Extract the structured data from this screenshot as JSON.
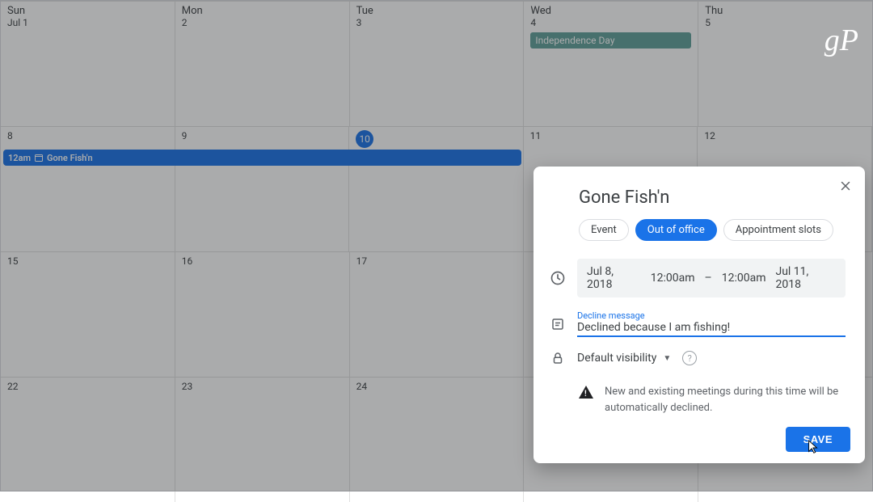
{
  "watermark": "gP",
  "calendar": {
    "weekdays": [
      "Sun",
      "Mon",
      "Tue",
      "Wed",
      "Thu"
    ],
    "today_weekday_index": 2,
    "weeks": [
      {
        "days": [
          {
            "label": "Jul 1"
          },
          {
            "label": "2"
          },
          {
            "label": "3"
          },
          {
            "label": "4",
            "holiday": "Independence Day"
          },
          {
            "label": "5"
          }
        ]
      },
      {
        "days": [
          {
            "label": "8"
          },
          {
            "label": "9"
          },
          {
            "label": "10",
            "today": true
          },
          {
            "label": "11"
          },
          {
            "label": "12"
          }
        ],
        "event": {
          "time": "12am",
          "title": "Gone Fish'n",
          "span_cols": 3
        }
      },
      {
        "days": [
          {
            "label": "15"
          },
          {
            "label": "16"
          },
          {
            "label": "17"
          },
          {
            "label": ""
          },
          {
            "label": ""
          }
        ]
      },
      {
        "days": [
          {
            "label": "22"
          },
          {
            "label": "23"
          },
          {
            "label": "24"
          },
          {
            "label": ""
          },
          {
            "label": ""
          }
        ]
      }
    ]
  },
  "modal": {
    "title": "Gone Fish'n",
    "tabs": {
      "event": "Event",
      "out_of_office": "Out of office",
      "appointment_slots": "Appointment slots"
    },
    "time": {
      "start_date": "Jul 8, 2018",
      "start_time": "12:00am",
      "dash": "–",
      "end_time": "12:00am",
      "end_date": "Jul 11, 2018"
    },
    "decline": {
      "label": "Decline message",
      "value": "Declined because I am fishing!"
    },
    "visibility": "Default visibility",
    "notice": "New and existing meetings during this time will be automatically declined.",
    "save": "SAVE"
  }
}
